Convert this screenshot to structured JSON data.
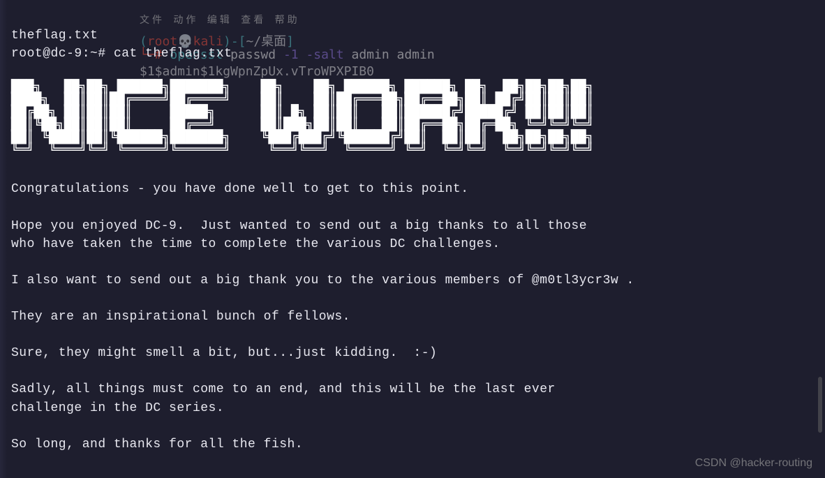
{
  "bg": {
    "menu": "文件  动作  编辑  查看  帮助",
    "path1": "~/桌面",
    "cmd1_prefix": "openssl",
    "cmd1_mid": "passwd",
    "cmd1_flags": "-1 -salt",
    "cmd1_args": "admin admin",
    "hash1": "$1$admin$1kgWpnZpUx.vTroWPXPIB0"
  },
  "terminal": {
    "line1": "theflag.txt",
    "prompt": "root@dc-9:~# ",
    "command": "cat theflag.txt",
    "ascii": "█▀▀▀▀▀█ █  ▀  ▀▀▀▀▀ ▀▀▀▀▀   █   █ ▀▀▀▀▀ ▀▀▀▀█ █  █  █ █ █\n█ █▀█ █ █  █  █     █       █ █ █ █   █ █▄▄▄█ █▄▀   █ █ █\n█ █ █ █ █  █  █     █▀▀     █▄█▄█ █   █ █ ▀▄  █▀▄   ▀ ▀ ▀\n█ ▀▀▀ █ █  ▀  ▀▀▀▀▀ ▀▀▀▀▀   ▀   ▀ ▀▀▀▀▀ ▀  ▀▀ ▀  ▀  ▀ ▀ ▀",
    "body": "\nCongratulations - you have done well to get to this point.\n\nHope you enjoyed DC-9.  Just wanted to send out a big thanks to all those\nwho have taken the time to complete the various DC challenges.\n\nI also want to send out a big thank you to the various members of @m0tl3ycr3w .\n\nThey are an inspirational bunch of fellows.\n\nSure, they might smell a bit, but...just kidding.  :-)\n\nSadly, all things must come to an end, and this will be the last ever\nchallenge in the DC series.\n\nSo long, and thanks for all the fish."
  },
  "watermark": "CSDN @hacker-routing"
}
